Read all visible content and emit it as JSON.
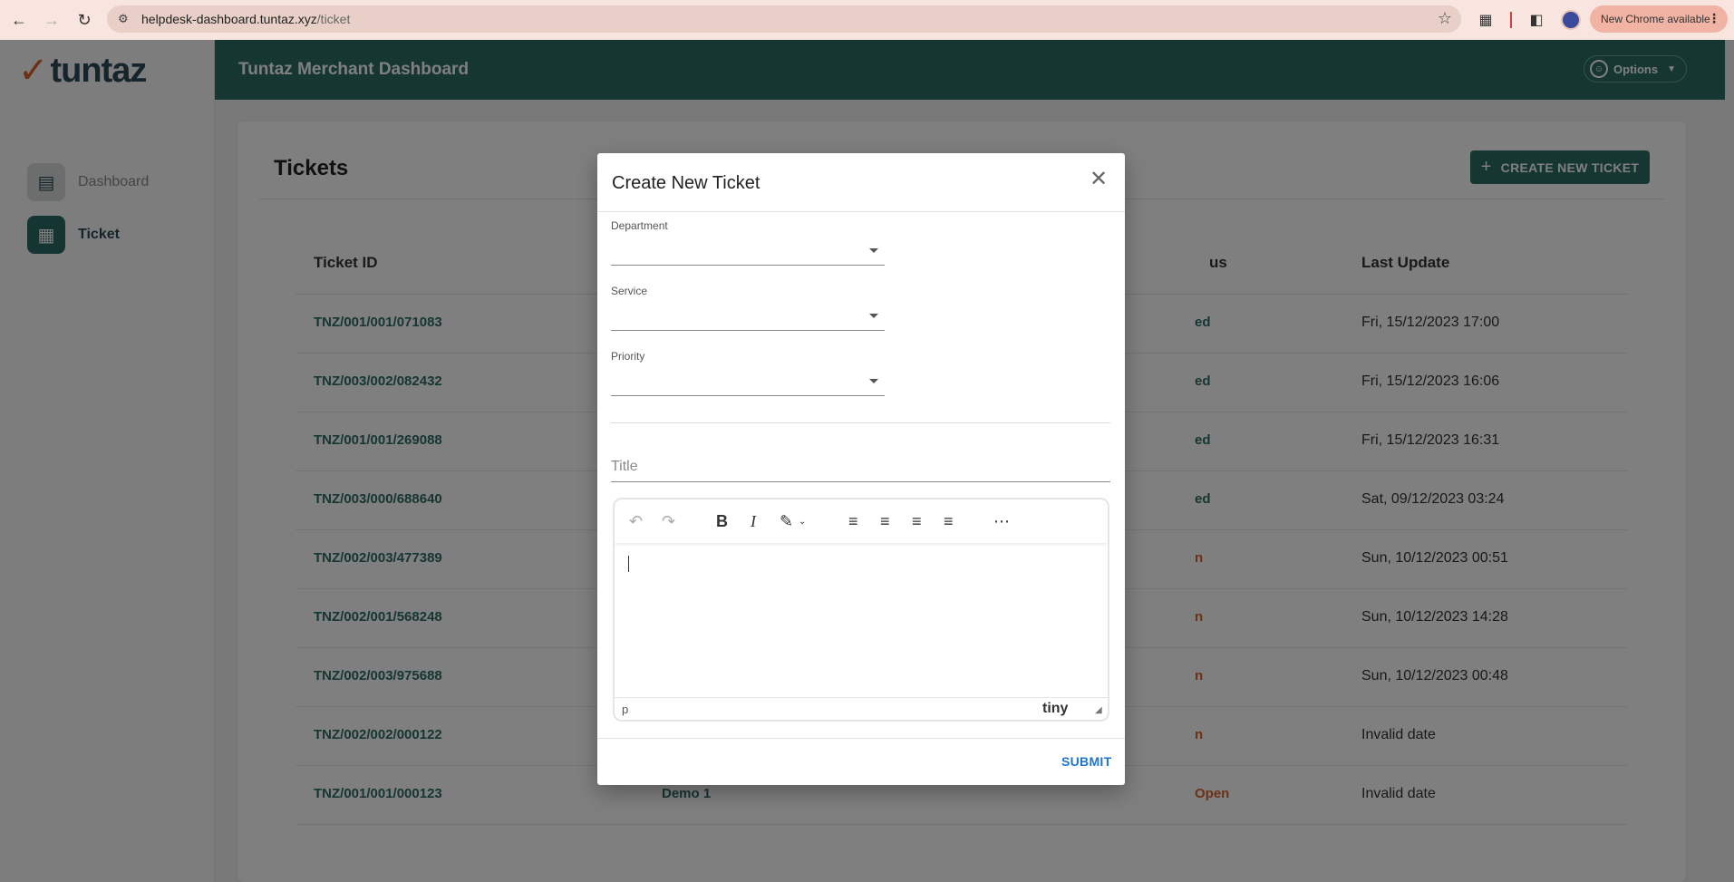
{
  "browser": {
    "url_host": "helpdesk-dashboard.tuntaz.xyz",
    "url_path": "/ticket",
    "new_chrome_label": "New Chrome available"
  },
  "sidebar": {
    "logo_text": "tuntaz",
    "items": [
      {
        "label": "Dashboard",
        "icon": "dashboard-icon"
      },
      {
        "label": "Ticket",
        "icon": "ticket-icon"
      }
    ]
  },
  "header": {
    "title": "Tuntaz Merchant Dashboard",
    "options_label": "Options"
  },
  "tickets": {
    "title": "Tickets",
    "create_label": "CREATE NEW TICKET",
    "columns": {
      "id": "Ticket ID",
      "status_fragment": "us",
      "last_update": "Last Update"
    },
    "rows": [
      {
        "id": "TNZ/001/001/071083",
        "service": "",
        "status": "ed",
        "status_type": "closed",
        "last_update": "Fri, 15/12/2023 17:00"
      },
      {
        "id": "TNZ/003/002/082432",
        "service": "",
        "status": "ed",
        "status_type": "closed",
        "last_update": "Fri, 15/12/2023 16:06"
      },
      {
        "id": "TNZ/001/001/269088",
        "service": "",
        "status": "ed",
        "status_type": "closed",
        "last_update": "Fri, 15/12/2023 16:31"
      },
      {
        "id": "TNZ/003/000/688640",
        "service": "",
        "status": "ed",
        "status_type": "closed",
        "last_update": "Sat, 09/12/2023 03:24"
      },
      {
        "id": "TNZ/002/003/477389",
        "service": "",
        "status": "n",
        "status_type": "open",
        "last_update": "Sun, 10/12/2023 00:51"
      },
      {
        "id": "TNZ/002/001/568248",
        "service": "",
        "status": "n",
        "status_type": "open",
        "last_update": "Sun, 10/12/2023 14:28"
      },
      {
        "id": "TNZ/002/003/975688",
        "service": "",
        "status": "n",
        "status_type": "open",
        "last_update": "Sun, 10/12/2023 00:48"
      },
      {
        "id": "TNZ/002/002/000122",
        "service": "",
        "status": "n",
        "status_type": "open",
        "last_update": "Invalid date"
      },
      {
        "id": "TNZ/001/001/000123",
        "service": "Demo 1",
        "status": "Open",
        "status_type": "open",
        "last_update": "Invalid date"
      }
    ]
  },
  "modal": {
    "title": "Create New Ticket",
    "department_label": "Department",
    "service_label": "Service",
    "priority_label": "Priority",
    "title_placeholder": "Title",
    "editor_path": "p",
    "editor_brand": "tiny",
    "submit_label": "SUBMIT"
  },
  "colors": {
    "brand": "#2d6d64",
    "accent": "#d9622b",
    "link": "#1f76c9"
  }
}
